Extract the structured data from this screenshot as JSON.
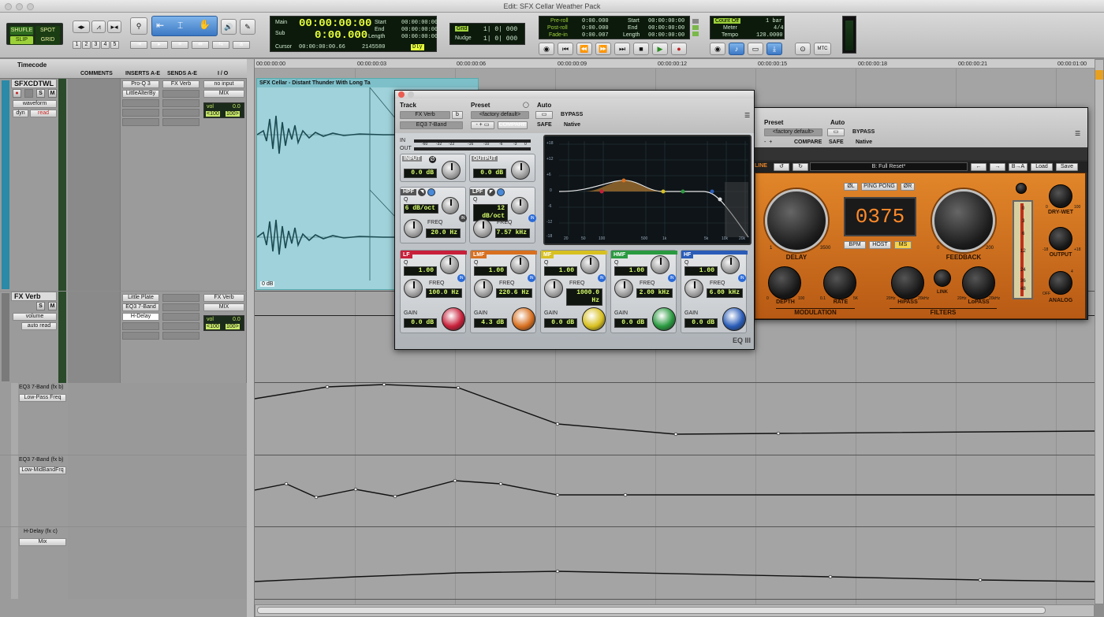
{
  "window": {
    "title": "Edit: SFX Cellar Weather Pack"
  },
  "toolbar": {
    "modes": [
      "SHUFLE",
      "SPOT",
      "SLIP",
      "GRID"
    ],
    "zoom_presets": [
      "1",
      "2",
      "3",
      "4",
      "5"
    ],
    "counter": {
      "main_label": "Main",
      "sub_label": "Sub",
      "main": "00:00:00:00",
      "sub": "0:00.000",
      "cursor_label": "Cursor",
      "cursor": "00:00:00:00.66",
      "cursor_val": "2145580",
      "dly": "Dly"
    },
    "selection": {
      "start_label": "Start",
      "end_label": "End",
      "length_label": "Length",
      "start": "00:00:00:00",
      "end": "00:00:00:00",
      "length": "00:00:00:00"
    },
    "grid": {
      "label": "Grid",
      "value": "1| 0| 000",
      "nudge_label": "Nudge",
      "nudge": "1| 0| 000"
    },
    "transport": {
      "preroll_label": "Pre-roll",
      "postroll_label": "Post-roll",
      "fadein_label": "Fade-in",
      "preroll": "0:00.000",
      "postroll": "0:00.000",
      "fadein": "0:00.007",
      "start_label": "Start",
      "end_label": "End",
      "length_label": "Length",
      "start": "00:00:00:00",
      "end": "00:00:00:00",
      "length": "00:00:00:00"
    },
    "meter": {
      "countoff": "Count Off",
      "bar": "1 bar",
      "meter_label": "Meter",
      "meter": "4/4",
      "tempo_label": "Tempo",
      "tempo": "120.0000"
    },
    "mtc": "MTC"
  },
  "mix_header": {
    "timecode": "Timecode",
    "comments": "COMMENTS",
    "inserts": "INSERTS A-E",
    "sends": "SENDS A-E",
    "io": "I / O"
  },
  "ruler": {
    "ticks": [
      "00:00:00:00",
      "00:00:00:03",
      "00:00:00:06",
      "00:00:00:09",
      "00:00:00:12",
      "00:00:00:15",
      "00:00:00:18",
      "00:00:00:21",
      "00:00:01:00"
    ]
  },
  "tracks": [
    {
      "name": "SFXCDTWL",
      "view": "waveform",
      "dyn": "dyn",
      "auto": "read",
      "inserts": [
        "Pro-Q 3",
        "LittleAlterBy"
      ],
      "send": "FX Verb",
      "io_in": "no input",
      "io_out": "MIX",
      "vol_label": "vol",
      "vol": "0.0",
      "pan_l": "<100",
      "pan_r": "100>",
      "clip_name": "SFX Cellar - Distant Thunder With Long Ta",
      "clip_gain": "0 dB"
    },
    {
      "name": "FX Verb",
      "view": "volume",
      "auto": "auto read",
      "inserts": [
        "Little Plate",
        "EQ3 7-Band",
        "H-Delay"
      ],
      "io_in": "FX Verb",
      "io_out": "MIX",
      "vol_label": "vol",
      "vol": "0.0",
      "pan_l": "<100",
      "pan_r": "100>"
    }
  ],
  "auto_lanes": [
    {
      "plugin": "EQ3 7-Band (fx b)",
      "param": "Low-Pass Freq"
    },
    {
      "plugin": "EQ3 7-Band (fx b)",
      "param": "Low-MidBandFrq"
    },
    {
      "plugin": "H-Delay (fx c)",
      "param": "Mix"
    }
  ],
  "eq": {
    "track_label": "Track",
    "preset_label": "Preset",
    "auto_label": "Auto",
    "track": "FX Verb",
    "track_letter": "b",
    "insert": "EQ3 7-Band",
    "preset": "<factory default>",
    "compare": "COMPARE",
    "bypass": "BYPASS",
    "safe": "SAFE",
    "native": "Native",
    "in_label": "IN",
    "out_label": "OUT",
    "scale": [
      "-60",
      "-32",
      "-22",
      "-16",
      "-10",
      "-6",
      "-3",
      "0"
    ],
    "input_label": "INPUT",
    "input": "0.0 dB",
    "output_label": "OUTPUT",
    "output": "0.0 dB",
    "hpf_label": "HPF",
    "hpf_q": "6 dB/oct",
    "hpf_freq": "20.0 Hz",
    "lpf_label": "LPF",
    "lpf_q": "12 dB/oct",
    "lpf_freq": "7.57 kHz",
    "q_label": "Q",
    "freq_label": "FREQ",
    "gain_label": "GAIN",
    "graph_y": [
      "+18",
      "+12",
      "+6",
      "0",
      "-6",
      "-12",
      "-18"
    ],
    "graph_x": [
      "20",
      "50",
      "100",
      "500",
      "1k",
      "5k",
      "10k",
      "20k"
    ],
    "bands": [
      {
        "name": "LF",
        "q": "1.00",
        "freq": "100.0 Hz",
        "gain": "0.0 dB",
        "color": "#c8203a"
      },
      {
        "name": "LMF",
        "q": "1.00",
        "freq": "220.6 Hz",
        "gain": "4.3 dB",
        "color": "#d87020"
      },
      {
        "name": "MF",
        "q": "1.00",
        "freq": "1000.0 Hz",
        "gain": "0.0 dB",
        "color": "#d8c020"
      },
      {
        "name": "HMF",
        "q": "1.00",
        "freq": "2.00 kHz",
        "gain": "0.0 dB",
        "color": "#2a9a40"
      },
      {
        "name": "HF",
        "q": "1.00",
        "freq": "6.00 kHz",
        "gain": "0.0 dB",
        "color": "#2a5cb8"
      }
    ],
    "logo": "EQ III"
  },
  "delay": {
    "preset_label": "Preset",
    "auto_label": "Auto",
    "preset": "<factory default>",
    "compare": "COMPARE",
    "bypass": "BYPASS",
    "safe": "SAFE",
    "native": "Native",
    "line": "LINE",
    "preset_name": "B: Full Reset*",
    "ab": "B→A",
    "load": "Load",
    "save": "Save",
    "phase_l": "ØL",
    "pingpong": "PING PONG",
    "phase_r": "ØR",
    "display": "0375",
    "bpm": "BPM",
    "host": "HOST",
    "ms": "MS",
    "delay_label": "DELAY",
    "feedback_label": "FEEDBACK",
    "drywet_label": "DRY-WET",
    "output_label": "OUTPUT",
    "analog_label": "ANALOG",
    "depth_label": "DEPTH",
    "rate_label": "RATE",
    "modulation_label": "MODULATION",
    "hipass_label": "HiPASS",
    "link_label": "LINK",
    "lopass_label": "LoPASS",
    "filters_label": "FILTERS",
    "meter_scale": [
      "0",
      "3",
      "6",
      "12",
      "24",
      "36",
      "48"
    ],
    "delay_range": [
      "1",
      "3500"
    ],
    "feedback_range": [
      "0",
      "200"
    ],
    "drywet_range": [
      "0",
      "100"
    ],
    "output_range": [
      "-18",
      "+18"
    ],
    "analog_range": [
      "OFF",
      "4"
    ],
    "depth_range": [
      "0",
      "100"
    ],
    "rate_range": [
      "0.1",
      "5K"
    ],
    "hipass_range": [
      "20Hz",
      "20kHz"
    ],
    "lopass_range": [
      "20Hz",
      "20kHz"
    ]
  }
}
